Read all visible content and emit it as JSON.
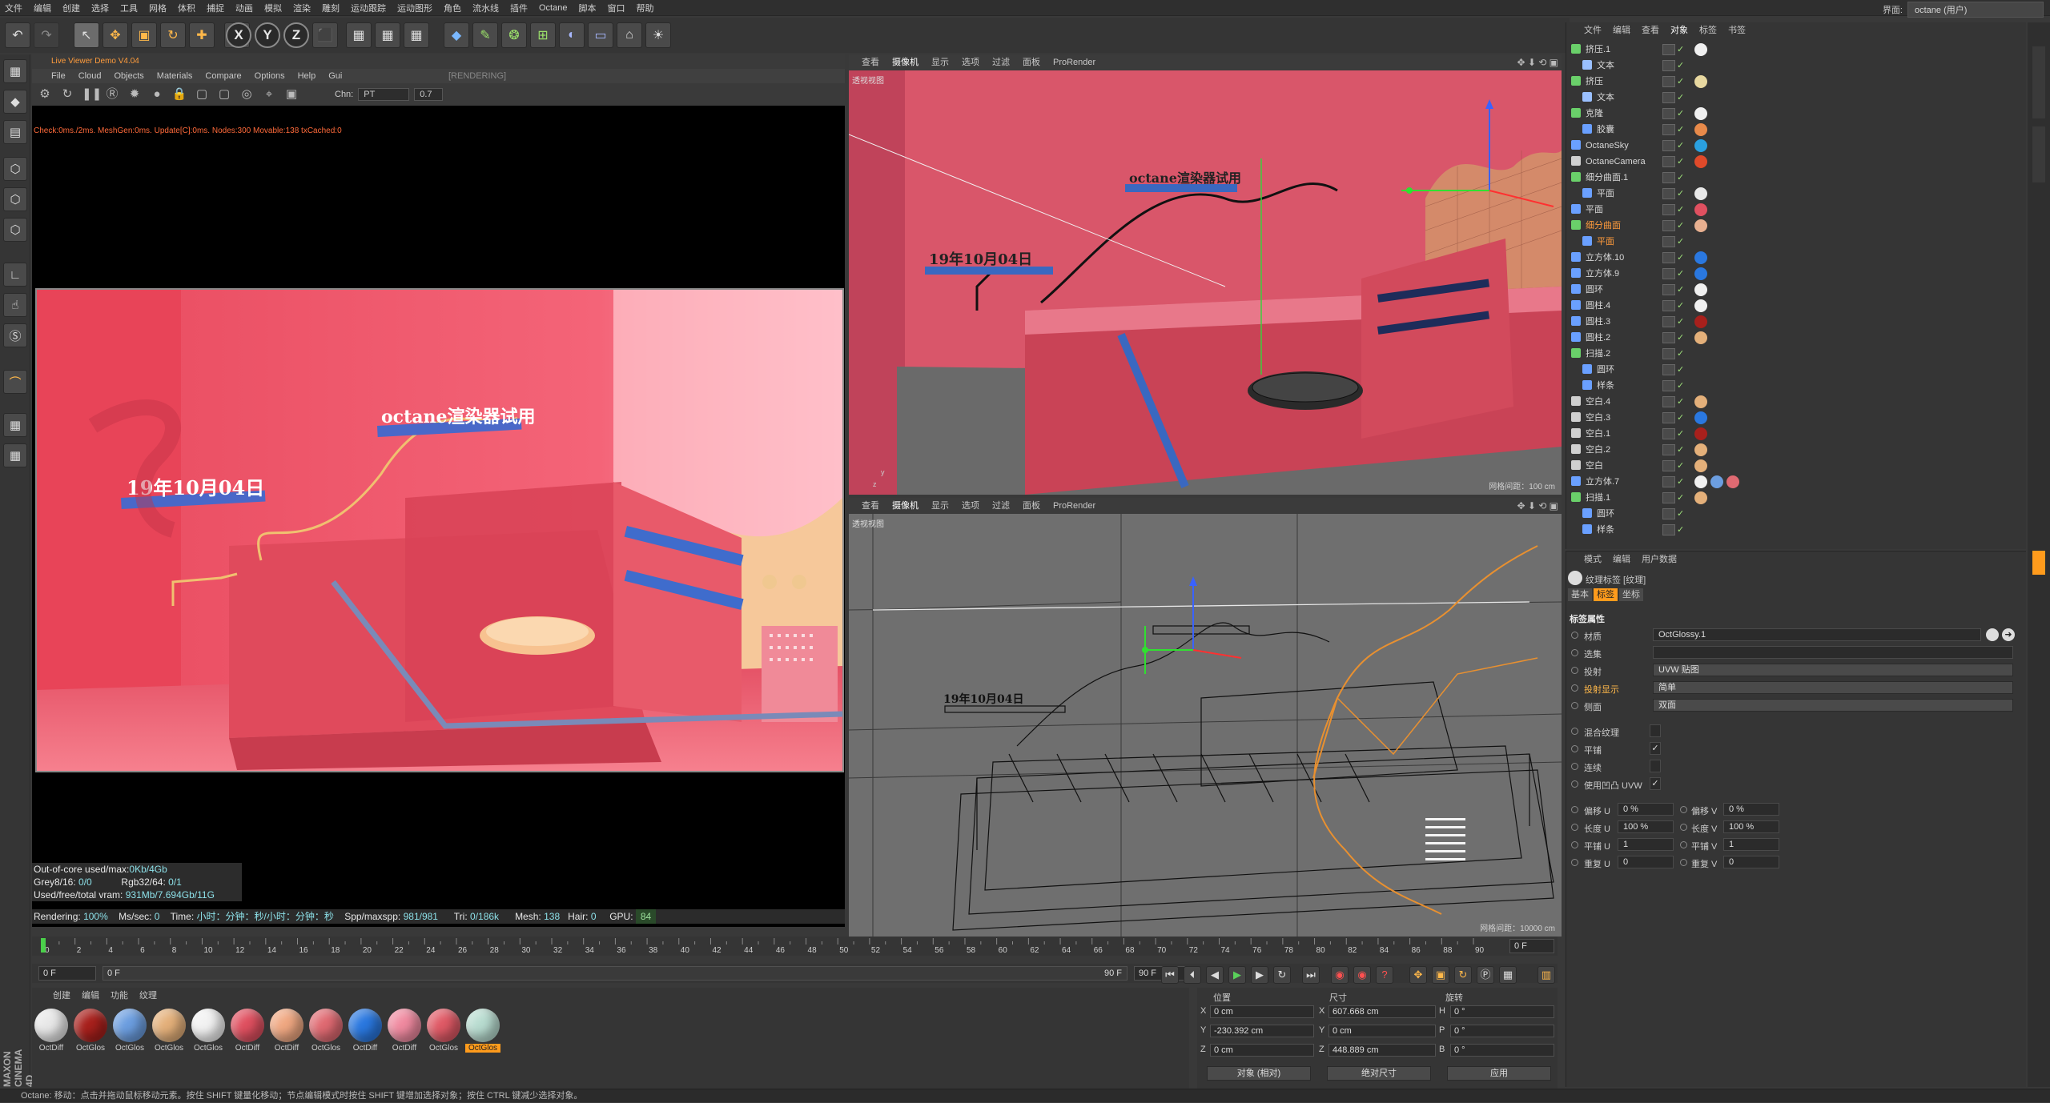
{
  "menubar": {
    "items": [
      "文件",
      "编辑",
      "创建",
      "选择",
      "工具",
      "网格",
      "体积",
      "捕捉",
      "动画",
      "模拟",
      "渲染",
      "雕刻",
      "运动跟踪",
      "运动图形",
      "角色",
      "流水线",
      "插件",
      "Octane",
      "脚本",
      "窗口",
      "帮助"
    ],
    "interface_label": "界面:",
    "interface_value": "octane (用户)"
  },
  "toolbar": {
    "undo": "↶",
    "redo": "↷",
    "tools": [
      "↖",
      "✥",
      "▣",
      "↻",
      "✚"
    ],
    "axes": [
      "X",
      "Y",
      "Z"
    ],
    "render": [
      "🎬",
      "🎬",
      "🎬"
    ]
  },
  "live_viewer": {
    "title": "Live Viewer Demo V4.04",
    "menu": [
      "File",
      "Cloud",
      "Objects",
      "Materials",
      "Compare",
      "Options",
      "Help",
      "Gui"
    ],
    "render_state": "[RENDERING]",
    "chn_label": "Chn:",
    "chn_value": "PT",
    "chn_gamma": "0.7",
    "stats_line": "Check:0ms./2ms. MeshGen:0ms. Update[C]:0ms. Nodes:300 Movable:138 txCached:0",
    "scene_text_1": "octane渲染器试用",
    "scene_text_2": "19年10月04日",
    "info": {
      "out_of_core_label": "Out-of-core used/max:",
      "out_of_core_value": "0Kb/4Gb",
      "grey_label": "Grey8/16:",
      "grey_value": "0/0",
      "rgb_label": "Rgb32/64:",
      "rgb_value": "0/1",
      "vram_label": "Used/free/total vram:",
      "vram_value": "931Mb/7.694Gb/11G"
    },
    "bar": {
      "rendering_label": "Rendering:",
      "rendering_value": "100%",
      "mssec_label": "Ms/sec:",
      "mssec_value": "0",
      "time_label": "Time:",
      "time_value": "小时：分钟：秒/小时：分钟：秒",
      "spp_label": "Spp/maxspp:",
      "spp_value": "981/981",
      "tri_label": "Tri:",
      "tri_value": "0/186k",
      "mesh_label": "Mesh:",
      "mesh_value": "138",
      "hair_label": "Hair:",
      "hair_value": "0",
      "gpu_label": "GPU:",
      "gpu_value": "84"
    }
  },
  "viewport_top": {
    "menu": [
      "查看",
      "摄像机",
      "显示",
      "选项",
      "过滤",
      "面板",
      "ProRender"
    ],
    "label": "透视视图",
    "grid": "网格间距：100 cm",
    "scene_text_1": "octane渲染器试用",
    "scene_text_2": "19年10月04日"
  },
  "viewport_bottom": {
    "menu": [
      "查看",
      "摄像机",
      "显示",
      "选项",
      "过滤",
      "面板",
      "ProRender"
    ],
    "label": "透视视图",
    "grid": "网格间距：10000 cm",
    "scene_text_2": "19年10月04日"
  },
  "timeline": {
    "ticks": [
      "0",
      "2",
      "4",
      "6",
      "8",
      "10",
      "12",
      "14",
      "16",
      "18",
      "20",
      "22",
      "24",
      "26",
      "28",
      "30",
      "32",
      "34",
      "36",
      "38",
      "40",
      "42",
      "44",
      "46",
      "48",
      "50",
      "52",
      "54",
      "56",
      "58",
      "60",
      "62",
      "64",
      "66",
      "68",
      "70",
      "72",
      "74",
      "76",
      "78",
      "80",
      "82",
      "84",
      "86",
      "88",
      "90"
    ],
    "current_frame": "0 F",
    "start_field": "0 F",
    "slider_start": "0 F",
    "slider_end": "90 F",
    "end_field": "90 F"
  },
  "materials": {
    "menu": [
      "创建",
      "编辑",
      "功能",
      "纹理"
    ],
    "items": [
      {
        "label": "OctDiff",
        "color": "#e8e8e8"
      },
      {
        "label": "OctGlos",
        "color": "#a8201c"
      },
      {
        "label": "OctGlos",
        "color": "#6c9ee0"
      },
      {
        "label": "OctGlos",
        "color": "#e4b07a"
      },
      {
        "label": "OctGlos",
        "color": "#f2f2f2"
      },
      {
        "label": "OctDiff",
        "color": "#e05060"
      },
      {
        "label": "OctDiff",
        "color": "#f0a882"
      },
      {
        "label": "OctGlos",
        "color": "#e06a72"
      },
      {
        "label": "OctDiff",
        "color": "#2a78e0"
      },
      {
        "label": "OctDiff",
        "color": "#f08aa0"
      },
      {
        "label": "OctGlos",
        "color": "#e05a66"
      },
      {
        "label": "OctGlos",
        "color": "#b8dcd0"
      }
    ]
  },
  "coords": {
    "pos_header": "位置",
    "size_header": "尺寸",
    "rot_header": "旋转",
    "rows": [
      {
        "axis": "X",
        "pos": "0 cm",
        "saxis": "X",
        "size": "607.668 cm",
        "raxis": "H",
        "rot": "0 °"
      },
      {
        "axis": "Y",
        "pos": "-230.392 cm",
        "saxis": "Y",
        "size": "0 cm",
        "raxis": "P",
        "rot": "0 °"
      },
      {
        "axis": "Z",
        "pos": "0 cm",
        "saxis": "Z",
        "size": "448.889 cm",
        "raxis": "B",
        "rot": "0 °"
      }
    ],
    "mode_select": "对象 (相对)",
    "size_select": "绝对尺寸",
    "apply": "应用"
  },
  "status": {
    "text": "Octane:    移动：点击并拖动鼠标移动元素。按住 SHIFT 键量化移动；节点编辑模式时按住 SHIFT 键增加选择对象；按住 CTRL 键减少选择对象。"
  },
  "object_manager": {
    "tabs": [
      "文件",
      "编辑",
      "查看",
      "对象",
      "标签",
      "书签"
    ],
    "rows": [
      {
        "name": "挤压.1",
        "indent": 0,
        "color": "#d8d8d8",
        "icon": "#6ad06a",
        "tags": [
          "#f0f0f0"
        ]
      },
      {
        "name": "文本",
        "indent": 1,
        "color": "#d8d8d8",
        "icon": "#9ac0ff",
        "tags": []
      },
      {
        "name": "挤压",
        "indent": 0,
        "color": "#d8d8d8",
        "icon": "#6ad06a",
        "tags": [
          "#e8d8a0"
        ]
      },
      {
        "name": "文本",
        "indent": 1,
        "color": "#d8d8d8",
        "icon": "#9ac0ff",
        "tags": []
      },
      {
        "name": "克隆",
        "indent": 0,
        "color": "#d8d8d8",
        "icon": "#6ad06a",
        "tags": [
          "#f0f0f0"
        ]
      },
      {
        "name": "胶囊",
        "indent": 1,
        "color": "#d8d8d8",
        "icon": "#6aa0ff",
        "tags": [
          "#e88a4a"
        ]
      },
      {
        "name": "OctaneSky",
        "indent": 0,
        "color": "#d8d8d8",
        "icon": "#6aa0ff",
        "tags": [
          "#2aa0e0"
        ]
      },
      {
        "name": "OctaneCamera",
        "indent": 0,
        "color": "#d8d8d8",
        "icon": "#d0d0d0",
        "tags": [
          "#e04a2a"
        ]
      },
      {
        "name": "细分曲面.1",
        "indent": 0,
        "color": "#d8d8d8",
        "icon": "#6ad06a",
        "tags": []
      },
      {
        "name": "平面",
        "indent": 1,
        "color": "#d8d8d8",
        "icon": "#6aa0ff",
        "tags": [
          "#e8e8e8"
        ]
      },
      {
        "name": "平面",
        "indent": 0,
        "color": "#d8d8d8",
        "icon": "#6aa0ff",
        "tags": [
          "#e05060"
        ]
      },
      {
        "name": "细分曲面",
        "indent": 0,
        "color": "#ff9b3c",
        "icon": "#6ad06a",
        "tags": [
          "#e8b090"
        ]
      },
      {
        "name": "平面",
        "indent": 1,
        "color": "#ff9b3c",
        "icon": "#6aa0ff",
        "tags": []
      },
      {
        "name": "立方体.10",
        "indent": 0,
        "color": "#d8d8d8",
        "icon": "#6aa0ff",
        "tags": [
          "#2a78e0"
        ]
      },
      {
        "name": "立方体.9",
        "indent": 0,
        "color": "#d8d8d8",
        "icon": "#6aa0ff",
        "tags": [
          "#2a78e0"
        ]
      },
      {
        "name": "圆环",
        "indent": 0,
        "color": "#d8d8d8",
        "icon": "#6aa0ff",
        "tags": [
          "#f0f0f0"
        ]
      },
      {
        "name": "圆柱.4",
        "indent": 0,
        "color": "#d8d8d8",
        "icon": "#6aa0ff",
        "tags": [
          "#f0f0f0"
        ]
      },
      {
        "name": "圆柱.3",
        "indent": 0,
        "color": "#d8d8d8",
        "icon": "#6aa0ff",
        "tags": [
          "#a8201c"
        ]
      },
      {
        "name": "圆柱.2",
        "indent": 0,
        "color": "#d8d8d8",
        "icon": "#6aa0ff",
        "tags": [
          "#e4b07a"
        ]
      },
      {
        "name": "扫描.2",
        "indent": 0,
        "color": "#d8d8d8",
        "icon": "#6ad06a",
        "tags": []
      },
      {
        "name": "圆环",
        "indent": 1,
        "color": "#d8d8d8",
        "icon": "#6aa0ff",
        "tags": []
      },
      {
        "name": "样条",
        "indent": 1,
        "color": "#d8d8d8",
        "icon": "#6aa0ff",
        "tags": []
      },
      {
        "name": "空白.4",
        "indent": 0,
        "color": "#d8d8d8",
        "icon": "#d0d0d0",
        "tags": [
          "#e4b07a"
        ]
      },
      {
        "name": "空白.3",
        "indent": 0,
        "color": "#d8d8d8",
        "icon": "#d0d0d0",
        "tags": [
          "#2a78e0"
        ]
      },
      {
        "name": "空白.1",
        "indent": 0,
        "color": "#d8d8d8",
        "icon": "#d0d0d0",
        "tags": [
          "#a8201c"
        ]
      },
      {
        "name": "空白.2",
        "indent": 0,
        "color": "#d8d8d8",
        "icon": "#d0d0d0",
        "tags": [
          "#e4b07a"
        ]
      },
      {
        "name": "空白",
        "indent": 0,
        "color": "#d8d8d8",
        "icon": "#d0d0d0",
        "tags": [
          "#e4b07a"
        ]
      },
      {
        "name": "立方体.7",
        "indent": 0,
        "color": "#d8d8d8",
        "icon": "#6aa0ff",
        "tags": [
          "#f0f0f0",
          "#6c9ee0",
          "#e06a72"
        ]
      },
      {
        "name": "扫描.1",
        "indent": 0,
        "color": "#d8d8d8",
        "icon": "#6ad06a",
        "tags": [
          "#e4b07a"
        ]
      },
      {
        "name": "圆环",
        "indent": 1,
        "color": "#d8d8d8",
        "icon": "#6aa0ff",
        "tags": []
      },
      {
        "name": "样条",
        "indent": 1,
        "color": "#d8d8d8",
        "icon": "#6aa0ff",
        "tags": []
      }
    ]
  },
  "attribute_manager": {
    "tabs": [
      "模式",
      "编辑",
      "用户数据"
    ],
    "title": "纹理标签 [纹理]",
    "subtabs": [
      "基本",
      "标签",
      "坐标"
    ],
    "section": "标签属性",
    "material_label": "材质",
    "material_value": "OctGlossy.1",
    "selection_label": "选集",
    "projection_label": "投射",
    "projection_value": "UVW 贴图",
    "projection_display_label": "投射显示",
    "projection_display_value": "简单",
    "side_label": "侧面",
    "side_value": "双面",
    "mix_label": "混合纹理",
    "tile_label": "平铺",
    "tile_checked": "✓",
    "continuous_label": "连续",
    "bump_label": "使用凹凸 UVW",
    "bump_checked": "✓",
    "offset_u_label": "偏移 U",
    "offset_u": "0 %",
    "offset_v_label": "偏移 V",
    "offset_v": "0 %",
    "len_u_label": "长度 U",
    "len_u": "100 %",
    "len_v_label": "长度 V",
    "len_v": "100 %",
    "tile_u_label": "平铺 U",
    "tile_u": "1",
    "tile_v_label": "平铺 V",
    "tile_v": "1",
    "rep_u_label": "重复 U",
    "rep_u": "0",
    "rep_v_label": "重复 V",
    "rep_v": "0"
  },
  "brand": "MAXON CINEMA 4D"
}
